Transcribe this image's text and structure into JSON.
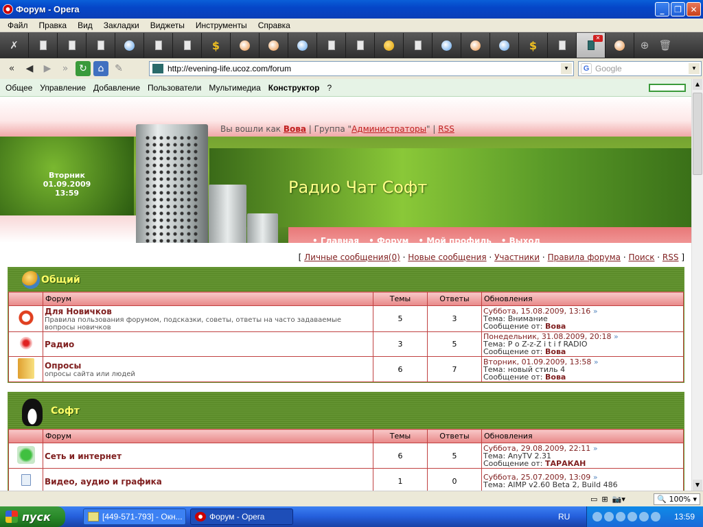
{
  "window": {
    "title": "Форум - Opera"
  },
  "menu": [
    "Файл",
    "Правка",
    "Вид",
    "Закладки",
    "Виджеты",
    "Инструменты",
    "Справка"
  ],
  "address": {
    "url": "http://evening-life.ucoz.com/forum",
    "search_placeholder": "Google"
  },
  "ucoz_bar": [
    "Общее",
    "Управление",
    "Добавление",
    "Пользователи",
    "Мультимедиа",
    "Конструктор",
    "?"
  ],
  "header": {
    "date_day": "Вторник",
    "date": "01.09.2009",
    "time": "13:59",
    "login_prefix": "Вы вошли как ",
    "user": "Вова",
    "group_prefix": " | Группа \"",
    "group": "Администраторы",
    "group_suffix": "\" | ",
    "rss": "RSS",
    "site_title": "Радио Чат Софт",
    "nav": [
      "Главная",
      "Форум",
      "Мой профиль",
      "Выход"
    ]
  },
  "toplinks": {
    "open": "[ ",
    "pm": "Личные сообщения(0)",
    "new": "Новые сообщения",
    "members": "Участники",
    "rules": "Правила форума",
    "search": "Поиск",
    "rss": "RSS",
    "close": " ]"
  },
  "columns": {
    "forum": "Форум",
    "topics": "Темы",
    "replies": "Ответы",
    "updates": "Обновления"
  },
  "categories": [
    {
      "title": "Общий",
      "forums": [
        {
          "name": "Для Новичков",
          "desc": "Правила пользования форумом, подсказки, советы, ответы на часто задаваемые вопросы новичков",
          "topics": "5",
          "replies": "3",
          "upd_date": "Суббота, 15.08.2009, 13:16",
          "upd_topic_label": "Тема: ",
          "upd_topic": "Внимание",
          "upd_by_label": "Сообщение от: ",
          "upd_by": "Вова"
        },
        {
          "name": "Радио",
          "desc": "",
          "topics": "3",
          "replies": "5",
          "upd_date": "Понедельник, 31.08.2009, 20:18",
          "upd_topic_label": "Тема: ",
          "upd_topic": "P o Z-z-Z i t i f RADIO",
          "upd_by_label": "Сообщение от: ",
          "upd_by": "Вова"
        },
        {
          "name": "Опросы",
          "desc": "опросы сайта или людей",
          "topics": "6",
          "replies": "7",
          "upd_date": "Вторник, 01.09.2009, 13:58",
          "upd_topic_label": "Тема: ",
          "upd_topic": "новый стиль 4",
          "upd_by_label": "Сообщение от: ",
          "upd_by": "Вова"
        }
      ]
    },
    {
      "title": "Софт",
      "forums": [
        {
          "name": "Сеть и интернет",
          "desc": "",
          "topics": "6",
          "replies": "5",
          "upd_date": "Суббота, 29.08.2009, 22:11",
          "upd_topic_label": "Тема: ",
          "upd_topic": "AnyTV 2.31",
          "upd_by_label": "Сообщение от: ",
          "upd_by": "ТАРАКАН"
        },
        {
          "name": "Видео, аудио и графика",
          "desc": "",
          "topics": "1",
          "replies": "0",
          "upd_date": "Суббота, 25.07.2009, 13:09",
          "upd_topic_label": "Тема: ",
          "upd_topic": "AIMP v2.60 Beta 2, Build 486",
          "upd_by_label": "",
          "upd_by": ""
        }
      ]
    }
  ],
  "status": {
    "zoom": "100%"
  },
  "taskbar": {
    "start": "пуск",
    "task1": "[449-571-793] - Окн...",
    "task2": "Форум - Opera",
    "lang": "RU",
    "clock": "13:59"
  }
}
